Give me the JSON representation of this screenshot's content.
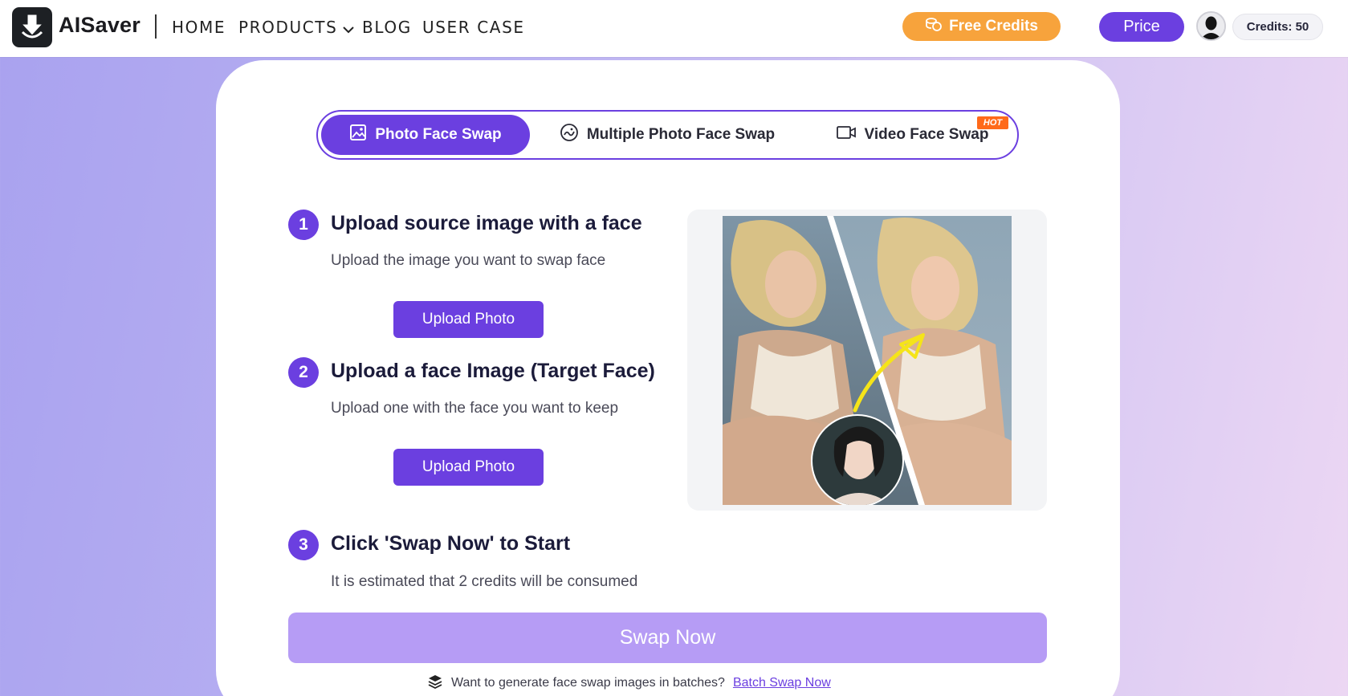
{
  "header": {
    "logo_text": "AISaver",
    "nav": [
      "HOME",
      "PRODUCTS",
      "BLOG",
      "USER CASE"
    ],
    "free_credits_label": "Free Credits",
    "price_label": "Price",
    "credits_label": "Credits: 50"
  },
  "tabs": [
    {
      "label": "Photo Face Swap",
      "icon": "image-icon",
      "active": true
    },
    {
      "label": "Multiple Photo Face Swap",
      "icon": "multi-face-icon",
      "active": false
    },
    {
      "label": "Video Face Swap",
      "icon": "video-icon",
      "active": false
    }
  ],
  "hot_badge": "HOT",
  "steps": [
    {
      "num": "1",
      "title": "Upload source image with a face",
      "desc": "Upload the image you want to swap face",
      "button": "Upload Photo"
    },
    {
      "num": "2",
      "title": "Upload a face Image (Target Face)",
      "desc": "Upload one with the face you want to keep",
      "button": "Upload Photo"
    },
    {
      "num": "3",
      "title": "Click 'Swap Now' to Start",
      "desc": "It is estimated that 2 credits will be consumed"
    }
  ],
  "swap_now_label": "Swap Now",
  "batch": {
    "text": "Want to generate face swap images in batches?",
    "link": "Batch Swap Now"
  },
  "colors": {
    "accent": "#6b3fe0",
    "free_credits": "#f7a33c",
    "hot": "#ff6a1a",
    "swap_disabled": "#b69cf5"
  }
}
